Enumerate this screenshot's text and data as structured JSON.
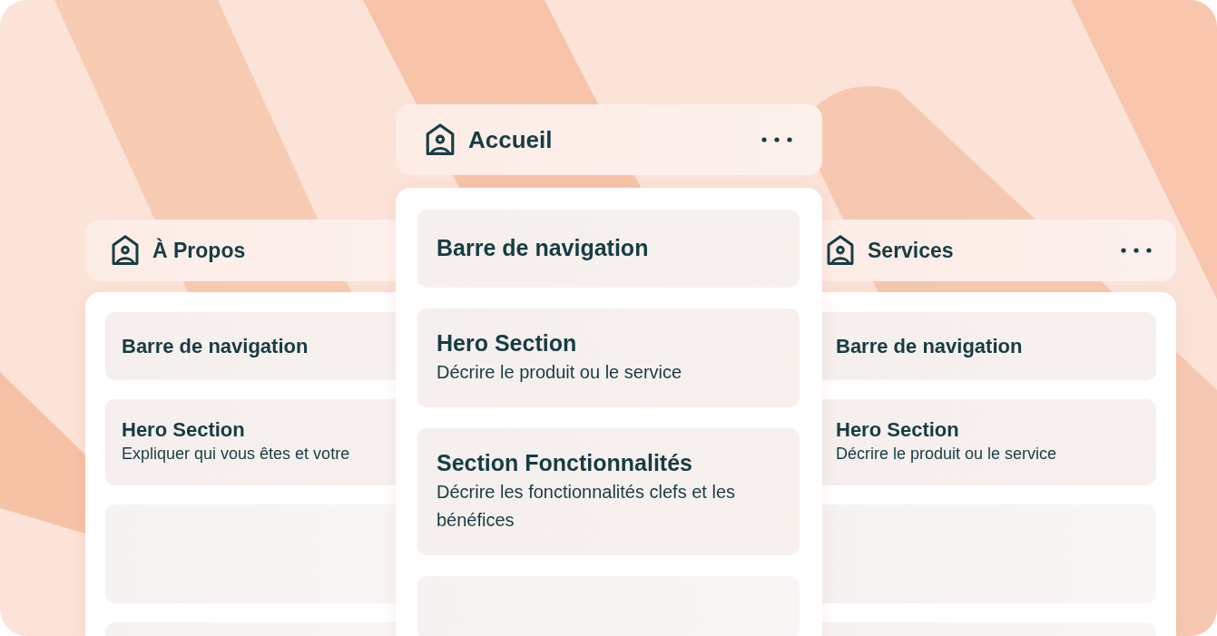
{
  "columns": [
    {
      "title": "À Propos",
      "menu": false,
      "cards": [
        {
          "kind": "section",
          "title": "Barre de navigation"
        },
        {
          "kind": "section",
          "title": "Hero Section",
          "description": "Expliquer qui vous êtes et votre"
        },
        {
          "kind": "placeholder"
        },
        {
          "kind": "placeholder"
        }
      ]
    },
    {
      "title": "Accueil",
      "menu": true,
      "cards": [
        {
          "kind": "section",
          "title": "Barre de navigation"
        },
        {
          "kind": "section",
          "title": "Hero Section",
          "description": "Décrire le produit ou le service"
        },
        {
          "kind": "section",
          "title": "Section Fonctionnalités",
          "description": "Décrire les fonctionnalités clefs et les bénéfices"
        },
        {
          "kind": "placeholder"
        }
      ]
    },
    {
      "title": "Services",
      "menu": true,
      "cards": [
        {
          "kind": "section",
          "title": "Barre de navigation"
        },
        {
          "kind": "section",
          "title": "Hero Section",
          "description": "Décrire le produit ou le service"
        },
        {
          "kind": "placeholder"
        },
        {
          "kind": "placeholder"
        }
      ]
    }
  ]
}
